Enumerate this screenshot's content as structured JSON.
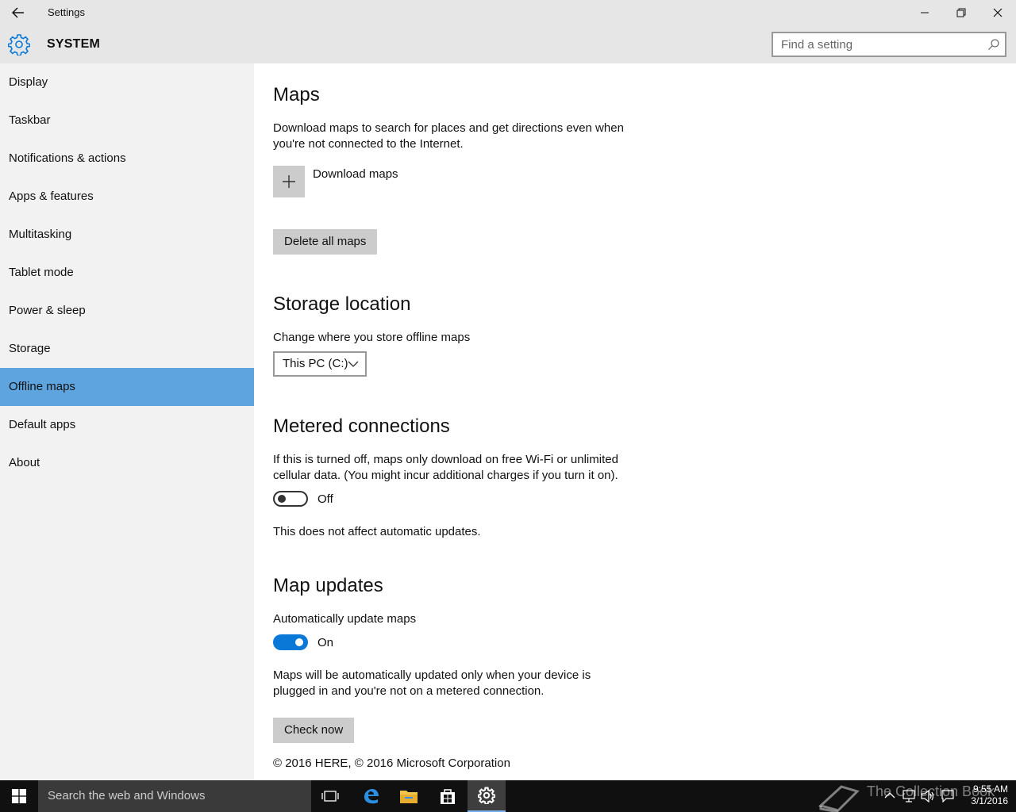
{
  "window": {
    "title": "Settings",
    "back_icon": "back-arrow-icon",
    "minimize_icon": "minimize-icon",
    "maximize_icon": "restore-icon",
    "close_icon": "close-icon"
  },
  "header": {
    "section": "SYSTEM",
    "icon": "gear-icon",
    "search_placeholder": "Find a setting"
  },
  "sidebar": {
    "items": [
      {
        "label": "Display"
      },
      {
        "label": "Taskbar"
      },
      {
        "label": "Notifications & actions"
      },
      {
        "label": "Apps & features"
      },
      {
        "label": "Multitasking"
      },
      {
        "label": "Tablet mode"
      },
      {
        "label": "Power & sleep"
      },
      {
        "label": "Storage"
      },
      {
        "label": "Offline maps",
        "selected": true
      },
      {
        "label": "Default apps"
      },
      {
        "label": "About"
      }
    ],
    "selected_color": "#5ea5e0"
  },
  "maps": {
    "heading": "Maps",
    "description": "Download maps to search for places and get directions even when you're not connected to the Internet.",
    "download_label": "Download maps",
    "delete_button": "Delete all maps"
  },
  "storage": {
    "heading": "Storage location",
    "label": "Change where you store offline maps",
    "selected": "This PC (C:)"
  },
  "metered": {
    "heading": "Metered connections",
    "description": "If this is turned off, maps only download on free Wi-Fi or unlimited cellular data. (You might incur additional charges if you turn it on).",
    "toggle_state": "Off",
    "toggle_on": false,
    "note": "This does not affect automatic updates."
  },
  "updates": {
    "heading": "Map updates",
    "label": "Automatically update maps",
    "toggle_state": "On",
    "toggle_on": true,
    "description": "Maps will be automatically updated only when your device is plugged in and you're not on a metered connection.",
    "check_button": "Check now",
    "copyright": "© 2016 HERE, © 2016 Microsoft Corporation"
  },
  "taskbar": {
    "search_text": "Search the web and Windows",
    "time": "9:55 AM",
    "date": "3/1/2016",
    "watermark": "The Collection Book",
    "accent": "#0a78d7"
  }
}
